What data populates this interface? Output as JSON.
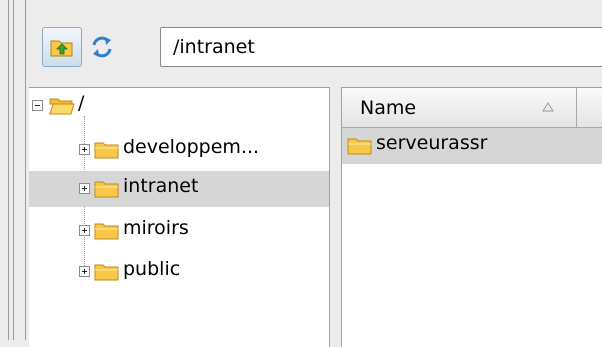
{
  "toolbar": {
    "up_icon": "folder-up-icon",
    "refresh_icon": "refresh-icon",
    "path": "/intranet"
  },
  "tree": {
    "root": {
      "label": "/",
      "icon": "folder-open-icon",
      "expanded": true
    },
    "items": [
      {
        "label": "developpem...",
        "icon": "folder-icon",
        "selected": false
      },
      {
        "label": "intranet",
        "icon": "folder-icon",
        "selected": true
      },
      {
        "label": "miroirs",
        "icon": "folder-icon",
        "selected": false
      },
      {
        "label": "public",
        "icon": "folder-icon",
        "selected": false
      }
    ]
  },
  "list": {
    "columns": [
      {
        "label": "Name",
        "sort": "ascending"
      }
    ],
    "rows": [
      {
        "name": "serveurassr",
        "icon": "folder-icon",
        "selected": true
      }
    ]
  },
  "colors": {
    "folder": "#f7c84a",
    "selection": "#d6d6d6"
  }
}
